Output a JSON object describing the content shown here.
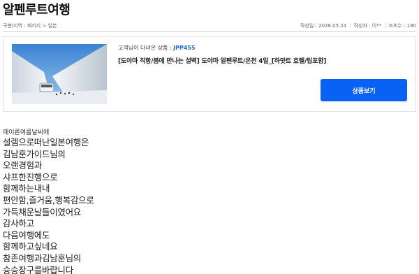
{
  "page": {
    "title": "알펜루트여행"
  },
  "meta": {
    "breadcrumb": "구분/지역 : 패키지 > 일본",
    "date": "작성일 : 2026.05.24",
    "author": "작성자 : 이**",
    "views": "조회수 : 190"
  },
  "product": {
    "code_prefix": "고객님이 다녀온 상품 : ",
    "code": "JPP455",
    "name": "[도야마 직항/봄에 만나는 설벽] 도야마 알펜루트/온천 4일_[하얏트 호텔/팁포함]",
    "button_label": "상품보기"
  },
  "review": {
    "heading": "때이른여름날씨에",
    "lines": [
      "설렘으로떠난일본여행은",
      "김남훈가이드님의",
      "오랜경험과",
      "샤프한진행으로",
      "함께하는내내",
      "편안함,즐거움,행복감으로",
      "가득채운날들이였어요",
      "감사하고",
      "다음여행에도",
      "함께하고싶네요",
      "참존여행과김남훈님의",
      "승승장구를바랍니다"
    ]
  }
}
